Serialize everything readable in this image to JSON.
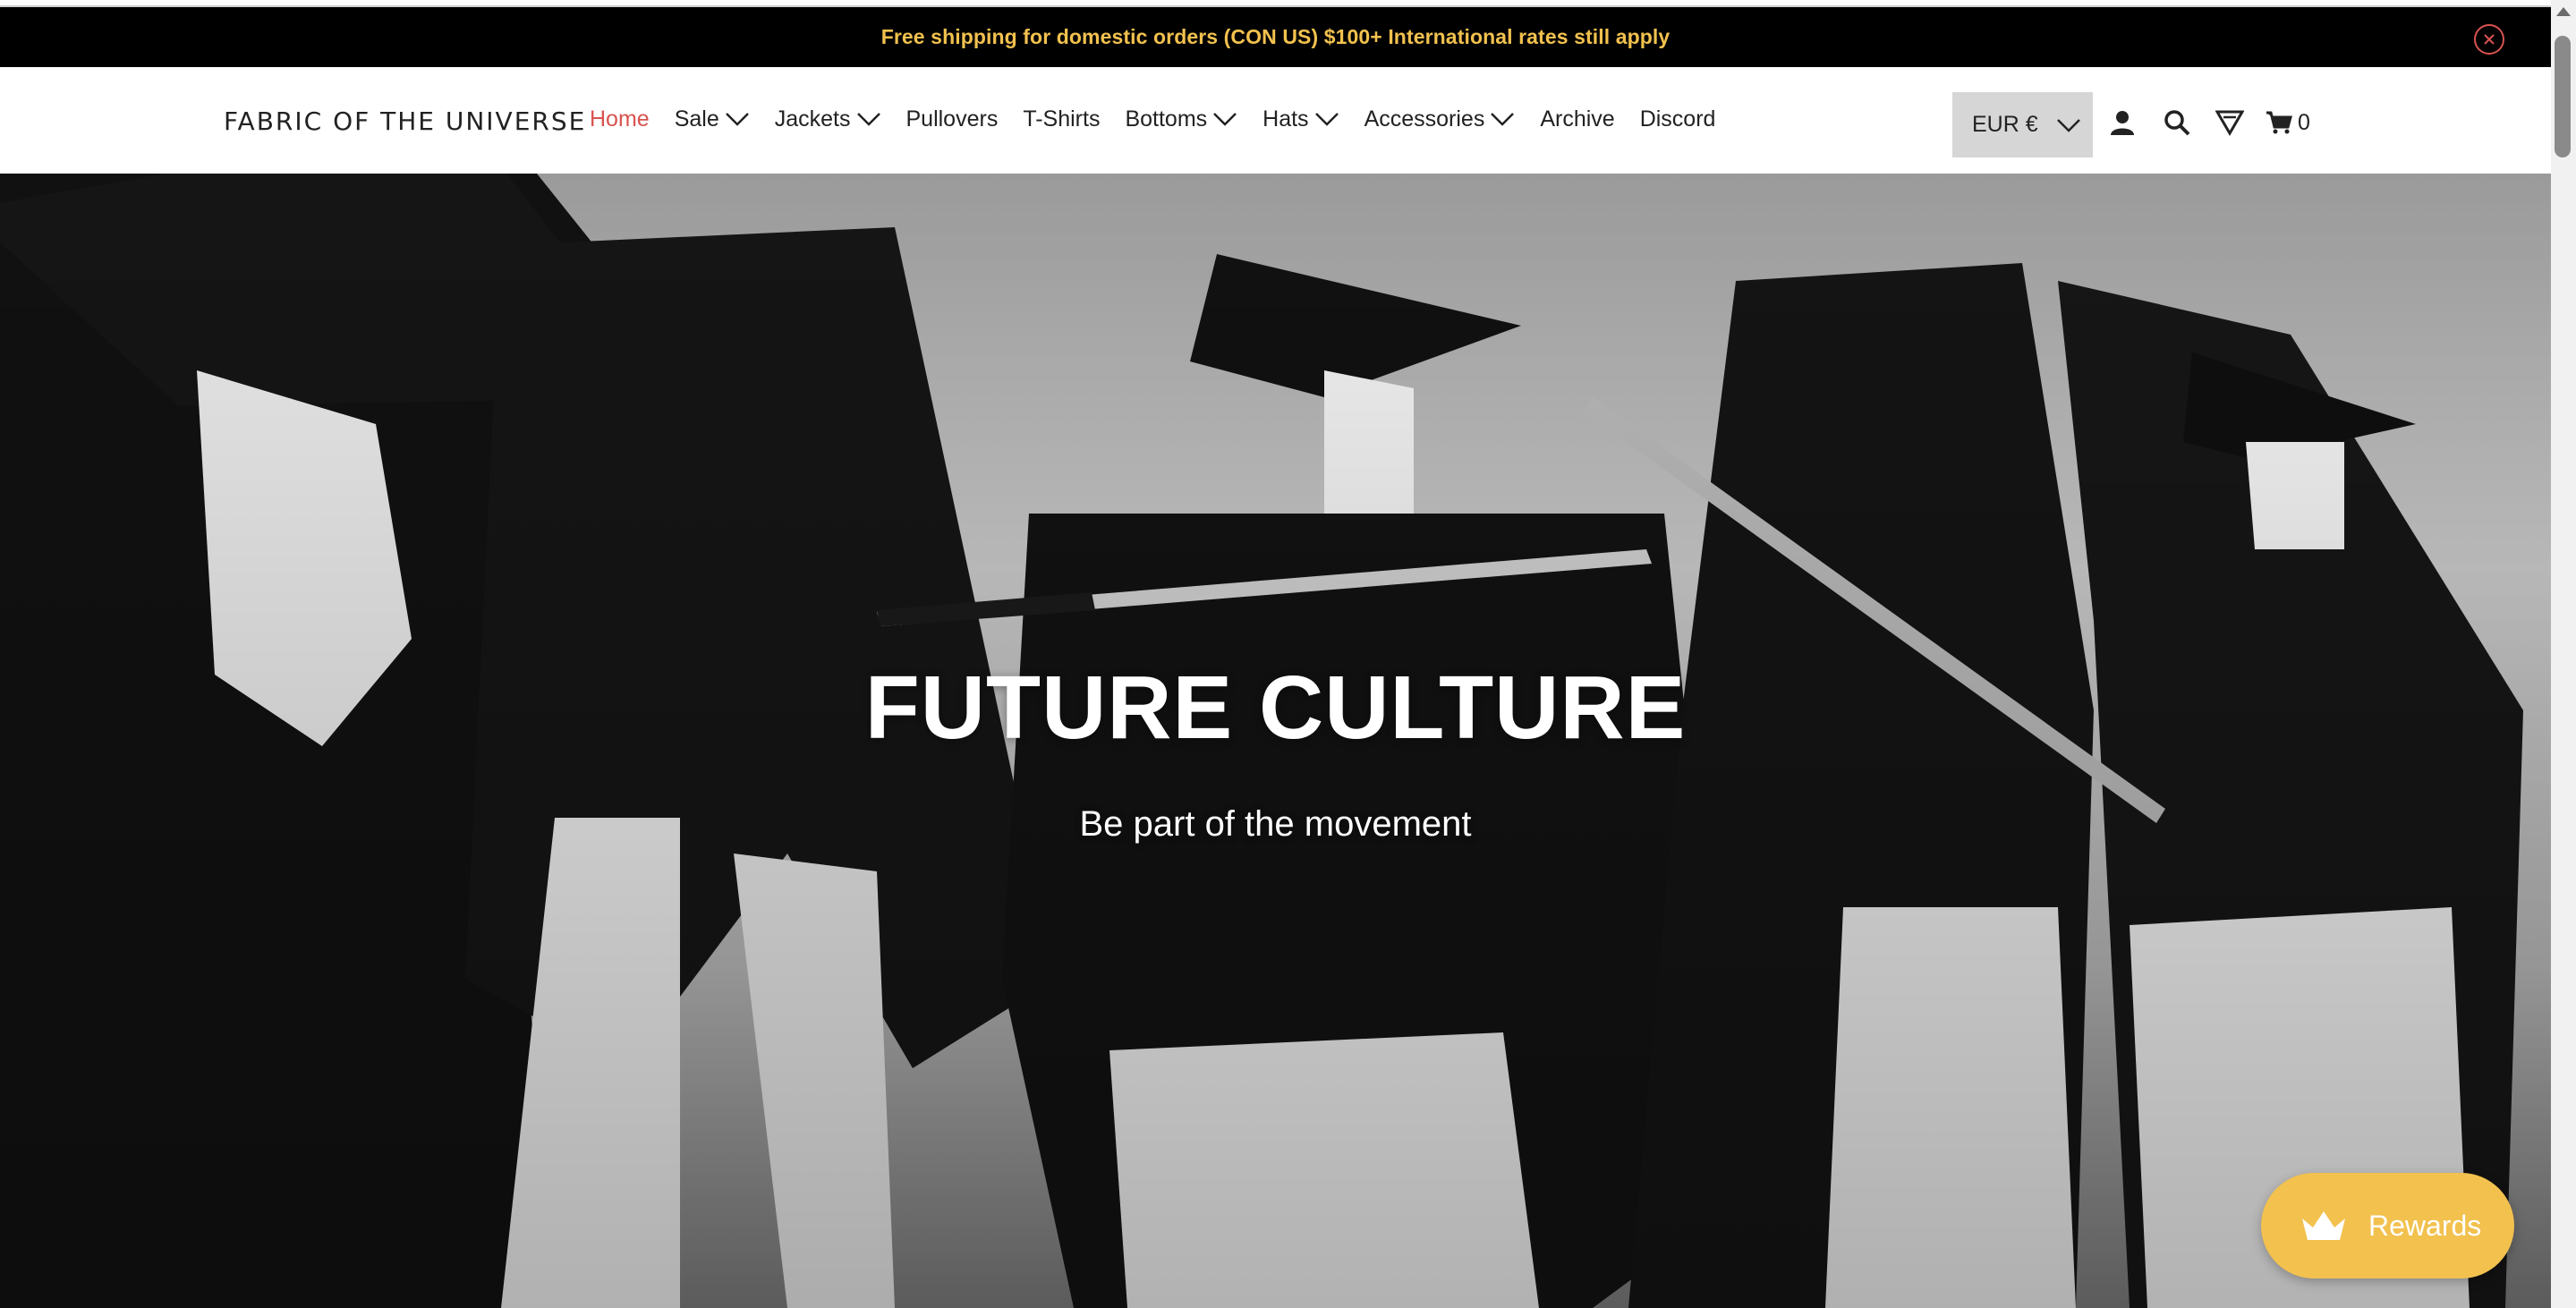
{
  "announcement": {
    "text": "Free shipping for domestic orders (CON US) $100+ International rates still apply",
    "text_color": "#f2c14e",
    "close_icon": "close-circle-icon"
  },
  "header": {
    "logo": "FABRIC OF THE UNIVERSE",
    "nav": [
      {
        "label": "Home",
        "active": true,
        "dropdown": false
      },
      {
        "label": "Sale",
        "active": false,
        "dropdown": true
      },
      {
        "label": "Jackets",
        "active": false,
        "dropdown": true
      },
      {
        "label": "Pullovers",
        "active": false,
        "dropdown": false
      },
      {
        "label": "T-Shirts",
        "active": false,
        "dropdown": false
      },
      {
        "label": "Bottoms",
        "active": false,
        "dropdown": true
      },
      {
        "label": "Hats",
        "active": false,
        "dropdown": true
      },
      {
        "label": "Accessories",
        "active": false,
        "dropdown": true
      },
      {
        "label": "Archive",
        "active": false,
        "dropdown": false
      },
      {
        "label": "Discord",
        "active": false,
        "dropdown": false
      }
    ],
    "currency": "EUR €",
    "icons": [
      "account-icon",
      "search-icon",
      "filter-icon",
      "cart-icon"
    ],
    "cart_count": "0",
    "active_color": "#d9534f"
  },
  "hero": {
    "title": "FUTURE CULTURE",
    "subtitle": "Be part of the movement"
  },
  "rewards": {
    "label": "Rewards",
    "icon": "crown-icon",
    "color": "#f2c14e"
  }
}
